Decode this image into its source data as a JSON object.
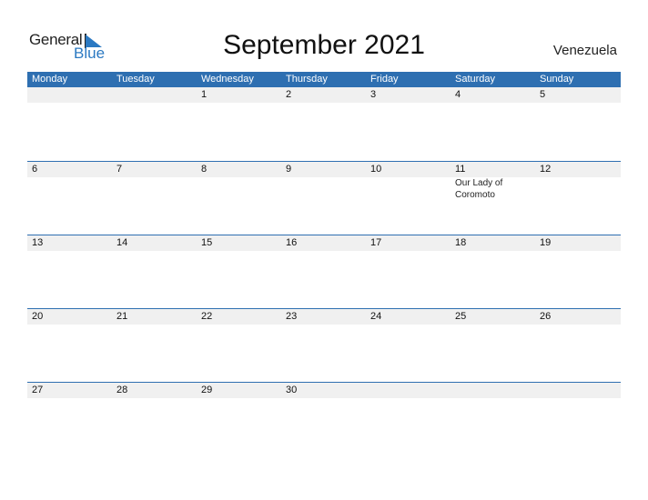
{
  "logo": {
    "line1": "General",
    "line2": "Blue"
  },
  "title": "September 2021",
  "country": "Venezuela",
  "colors": {
    "accent": "#2e6fb1",
    "date_strip": "#f0f0f0"
  },
  "weekdays": [
    "Monday",
    "Tuesday",
    "Wednesday",
    "Thursday",
    "Friday",
    "Saturday",
    "Sunday"
  ],
  "weeks": [
    {
      "days": [
        {
          "d": ""
        },
        {
          "d": ""
        },
        {
          "d": "1"
        },
        {
          "d": "2"
        },
        {
          "d": "3"
        },
        {
          "d": "4"
        },
        {
          "d": "5"
        }
      ]
    },
    {
      "days": [
        {
          "d": "6"
        },
        {
          "d": "7"
        },
        {
          "d": "8"
        },
        {
          "d": "9"
        },
        {
          "d": "10"
        },
        {
          "d": "11",
          "event": "Our Lady of Coromoto"
        },
        {
          "d": "12"
        }
      ]
    },
    {
      "days": [
        {
          "d": "13"
        },
        {
          "d": "14"
        },
        {
          "d": "15"
        },
        {
          "d": "16"
        },
        {
          "d": "17"
        },
        {
          "d": "18"
        },
        {
          "d": "19"
        }
      ]
    },
    {
      "days": [
        {
          "d": "20"
        },
        {
          "d": "21"
        },
        {
          "d": "22"
        },
        {
          "d": "23"
        },
        {
          "d": "24"
        },
        {
          "d": "25"
        },
        {
          "d": "26"
        }
      ]
    },
    {
      "days": [
        {
          "d": "27"
        },
        {
          "d": "28"
        },
        {
          "d": "29"
        },
        {
          "d": "30"
        },
        {
          "d": ""
        },
        {
          "d": ""
        },
        {
          "d": ""
        }
      ]
    }
  ]
}
